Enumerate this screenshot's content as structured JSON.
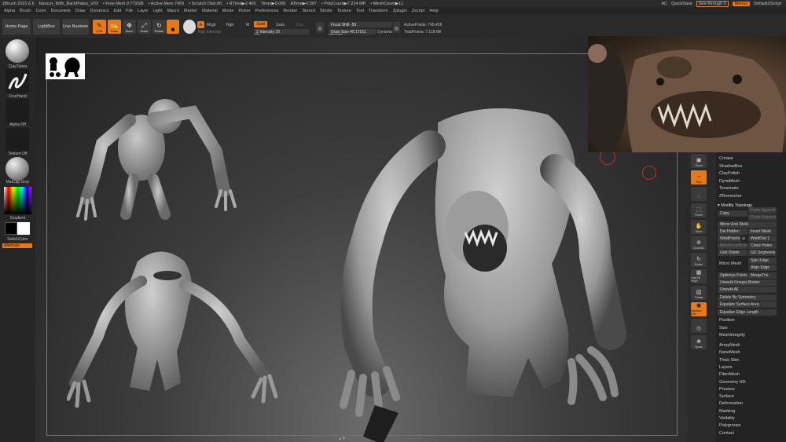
{
  "titlebar": {
    "app": "ZBrush 2021.6.6",
    "file": "Rancor_With_BackPlates_V03",
    "free_mem": "• Free Mem 9.772GB",
    "active_mem": "• Active Mem 7455",
    "scratch_disk": "• Scratch Disk 80",
    "rtime": "• RTime▶2.403",
    "timer": "Timer▶0.006",
    "atime": "ATime▶0.097",
    "polycount": "• PolyCount▶7.214 MP",
    "meshcount": "• MeshCount▶11",
    "ac": "AC",
    "quicksave": "QuickSave",
    "see_through": "See-through",
    "see_through_value": "0",
    "menus": "Menus",
    "default_script": "DefaultZScript"
  },
  "menubar": [
    "Alpha",
    "Brush",
    "Color",
    "Document",
    "Draw",
    "Dynamics",
    "Edit",
    "File",
    "Layer",
    "Light",
    "Macro",
    "Marker",
    "Material",
    "Movie",
    "Picker",
    "Preferences",
    "Render",
    "Stencil",
    "Stroke",
    "Texture",
    "Tool",
    "Transform",
    "Zplugin",
    "Zscript",
    "Help"
  ],
  "topshelf": {
    "home_page": "Home Page",
    "lightbox": "LightBox",
    "live_boolean": "Live Boolean",
    "tools": [
      {
        "label": "Edit",
        "glyph": "✎",
        "active": true
      },
      {
        "label": "Draw",
        "glyph": "✍",
        "active": true
      },
      {
        "label": "Move",
        "glyph": "✥",
        "active": false
      },
      {
        "label": "Scale",
        "glyph": "⤢",
        "active": false
      },
      {
        "label": "Rotate",
        "glyph": "↻",
        "active": false
      }
    ],
    "a_label": "A",
    "mrgb": "Mrgb",
    "rgb": "Rgb",
    "m": "M",
    "zadd": "Zadd",
    "zsub": "Zsub",
    "zcut": "Zcut",
    "rgb_intensity": "Rgb Intensity",
    "z_intensity": "Z Intensity 10",
    "z_intensity_value": 0.1,
    "focal_shift": "Focal Shift -56",
    "draw_size": "Draw Size 46.17211",
    "dynamic": "Dynamic",
    "active_points": "ActivePoints: 745,426",
    "total_points": "TotalPoints: 7.118 Mil"
  },
  "leftshelf": {
    "brush": "ClayTubes",
    "stroke": "FreeHand",
    "alpha": "Alpha Off",
    "texture": "Texture Off",
    "material": "MatCap Gray",
    "gradient": "Gradient",
    "switch_color": "SwitchColor",
    "alternate": "Alternate"
  },
  "rightshelf": [
    {
      "label": "Ghost",
      "glyph": "▣",
      "active": false
    },
    {
      "label": "Sym",
      "glyph": "⇔",
      "active": true
    },
    {
      "label": "",
      "glyph": "◌",
      "active": false
    },
    {
      "label": "Frame",
      "glyph": "⬚",
      "active": false
    },
    {
      "label": "Move",
      "glyph": "✋",
      "active": false
    },
    {
      "label": "Zoom3D",
      "glyph": "⊕",
      "active": false
    },
    {
      "label": "Rotate",
      "glyph": "↻",
      "active": false
    },
    {
      "label": "Line Fill PolyF",
      "glyph": "▦",
      "active": false
    },
    {
      "label": "Transp",
      "glyph": "▧",
      "active": false
    },
    {
      "label": "Dynamic Solo",
      "glyph": "◉",
      "active": true
    },
    {
      "label": "",
      "glyph": "◎",
      "active": false
    },
    {
      "label": "Xpose",
      "glyph": "❀",
      "active": false
    }
  ],
  "palette": {
    "items_top": [
      "Crease",
      "ShadowBox",
      "ClayPolish",
      "DynaMesh",
      "Tessimate",
      "ZRemesher"
    ],
    "modify_topology": "▾ Modify Topology",
    "copy": "Copy",
    "paste_append": "Paste Append",
    "paste_replace": "Paste Replace",
    "mirror_and_weld": "Mirror And Weld",
    "del_hidden": "Del Hidden",
    "insert_mesh": "Insert Mesh",
    "weld_points": "WeldPoints",
    "weld_dist": "WeldDist 1",
    "meshfrombrush": "MeshFromBrush",
    "close_holes": "Close Holes",
    "grid_divide": "Grid Divide",
    "gd_segments": "GD Segments 3",
    "micro_mesh": "Micro Mesh",
    "spin_edge": "Spin Edge",
    "align_edge": "Align Edge",
    "optimize_points": "Optimize Points",
    "merge_tris": "MergeTris",
    "unweld_groups_border": "Unweld Groups Border",
    "unweld_all": "Unweld All",
    "delete_by_symmetry": "Delete By Symmetry",
    "equalize_surface_area": "Equalize Surface Area",
    "equalize_edge_length": "Equalize Edge Length",
    "items_bottom": [
      "Position",
      "Size",
      "MeshIntegrity"
    ],
    "sections": [
      "ArrayMesh",
      "NanoMesh",
      "Thick Skin",
      "Layers",
      "FiberMesh",
      "Geometry HD",
      "Preview",
      "Surface",
      "Deformation",
      "Masking",
      "Visibility",
      "Polygroups",
      "Contact"
    ]
  },
  "colors": {
    "accent": "#e57a1c",
    "panel": "#2a2a2a",
    "viewport": "#3d3d3d"
  }
}
